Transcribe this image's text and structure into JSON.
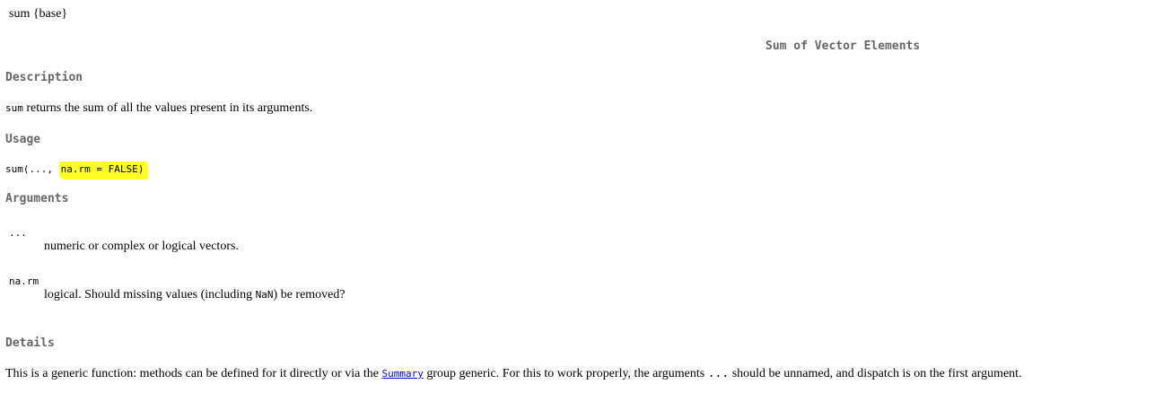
{
  "header": {
    "topic": "sum {base}",
    "title": "Sum of Vector Elements"
  },
  "description": {
    "heading": "Description",
    "code": "sum",
    "text": " returns the sum of all the values present in its arguments."
  },
  "usage": {
    "heading": "Usage",
    "code_prefix": "sum(..., ",
    "code_highlight": "na.rm = FALSE)",
    "highlight_color": "#ffff26"
  },
  "arguments": {
    "heading": "Arguments",
    "items": [
      {
        "name": "...",
        "desc_before": "numeric or complex or logical vectors.",
        "desc_code": "",
        "desc_after": ""
      },
      {
        "name": "na.rm",
        "desc_before": "logical. Should missing values (including ",
        "desc_code": "NaN",
        "desc_after": ") be removed?"
      }
    ]
  },
  "details": {
    "heading": "Details",
    "text_before": "This is a generic function: methods can be defined for it directly or via the ",
    "link_text": "Summary",
    "text_middle": " group generic. For this to work properly, the arguments ",
    "code_dots": "...",
    "text_after": " should be unnamed, and dispatch is on the first argument."
  }
}
